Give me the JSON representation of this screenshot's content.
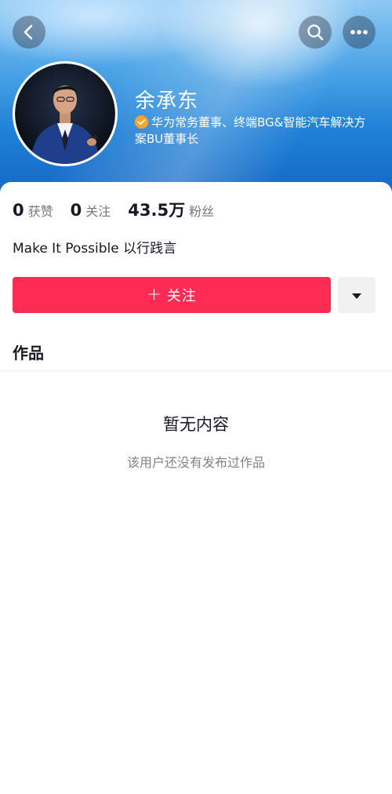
{
  "profile": {
    "name": "余承东",
    "verification": "华为常务董事、终端BG&智能汽车解决方案BU董事长",
    "bio": "Make It Possible 以行践言"
  },
  "stats": [
    {
      "value": "0",
      "label": "获赞"
    },
    {
      "value": "0",
      "label": "关注"
    },
    {
      "value": "43.5万",
      "label": "粉丝"
    }
  ],
  "actions": {
    "follow_label": "关注",
    "follow_plus": "+"
  },
  "works": {
    "title": "作品",
    "empty_title": "暂无内容",
    "empty_subtitle": "该用户还没有发布过作品"
  },
  "icons": {
    "back": "chevron-left-icon",
    "search": "search-icon",
    "more": "ellipsis-icon",
    "verified": "verified-badge-icon",
    "dropdown": "caret-down-icon"
  },
  "colors": {
    "accent": "#fe2c55",
    "verified": "#f5a623",
    "header_blue": "#1e7fd6"
  }
}
